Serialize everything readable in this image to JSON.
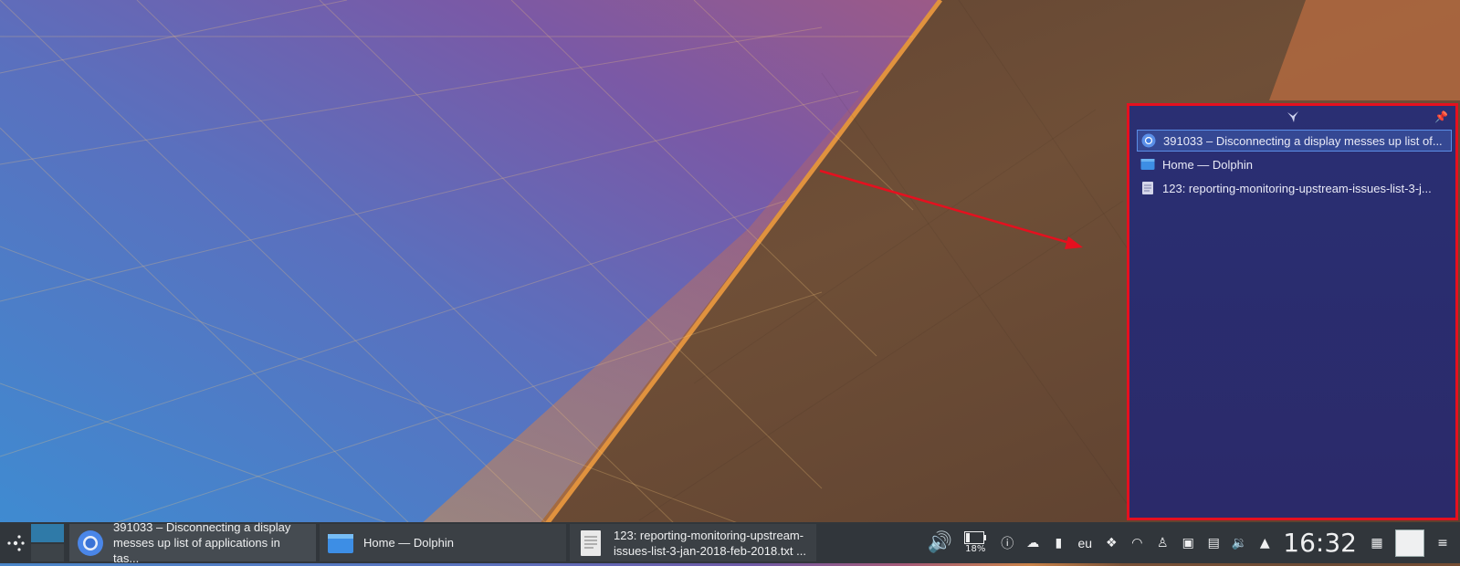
{
  "popup": {
    "items": [
      {
        "label": "391033 – Disconnecting a display messes up list of...",
        "icon": "chrome-icon",
        "active": true
      },
      {
        "label": "Home — Dolphin",
        "icon": "folder-icon",
        "active": false
      },
      {
        "label": "123: reporting-monitoring-upstream-issues-list-3-j...",
        "icon": "text-file-icon",
        "active": false
      }
    ]
  },
  "taskbar": {
    "tasks": [
      {
        "line1": "391033 – Disconnecting a display",
        "line2": "messes up list of applications in tas..."
      },
      {
        "line1": "Home — Dolphin",
        "line2": ""
      },
      {
        "line1": "123: reporting-monitoring-upstream-",
        "line2": "issues-list-3-jan-2018-feb-2018.txt  ..."
      }
    ],
    "battery_percent": "18%",
    "keyboard_layout": "eu",
    "clock": "16:32"
  },
  "colors": {
    "highlight_border": "#e5101f",
    "popup_bg": "#2a2f73",
    "taskbar_bg": "#31363b",
    "pager_active": "#2f7aa8"
  }
}
